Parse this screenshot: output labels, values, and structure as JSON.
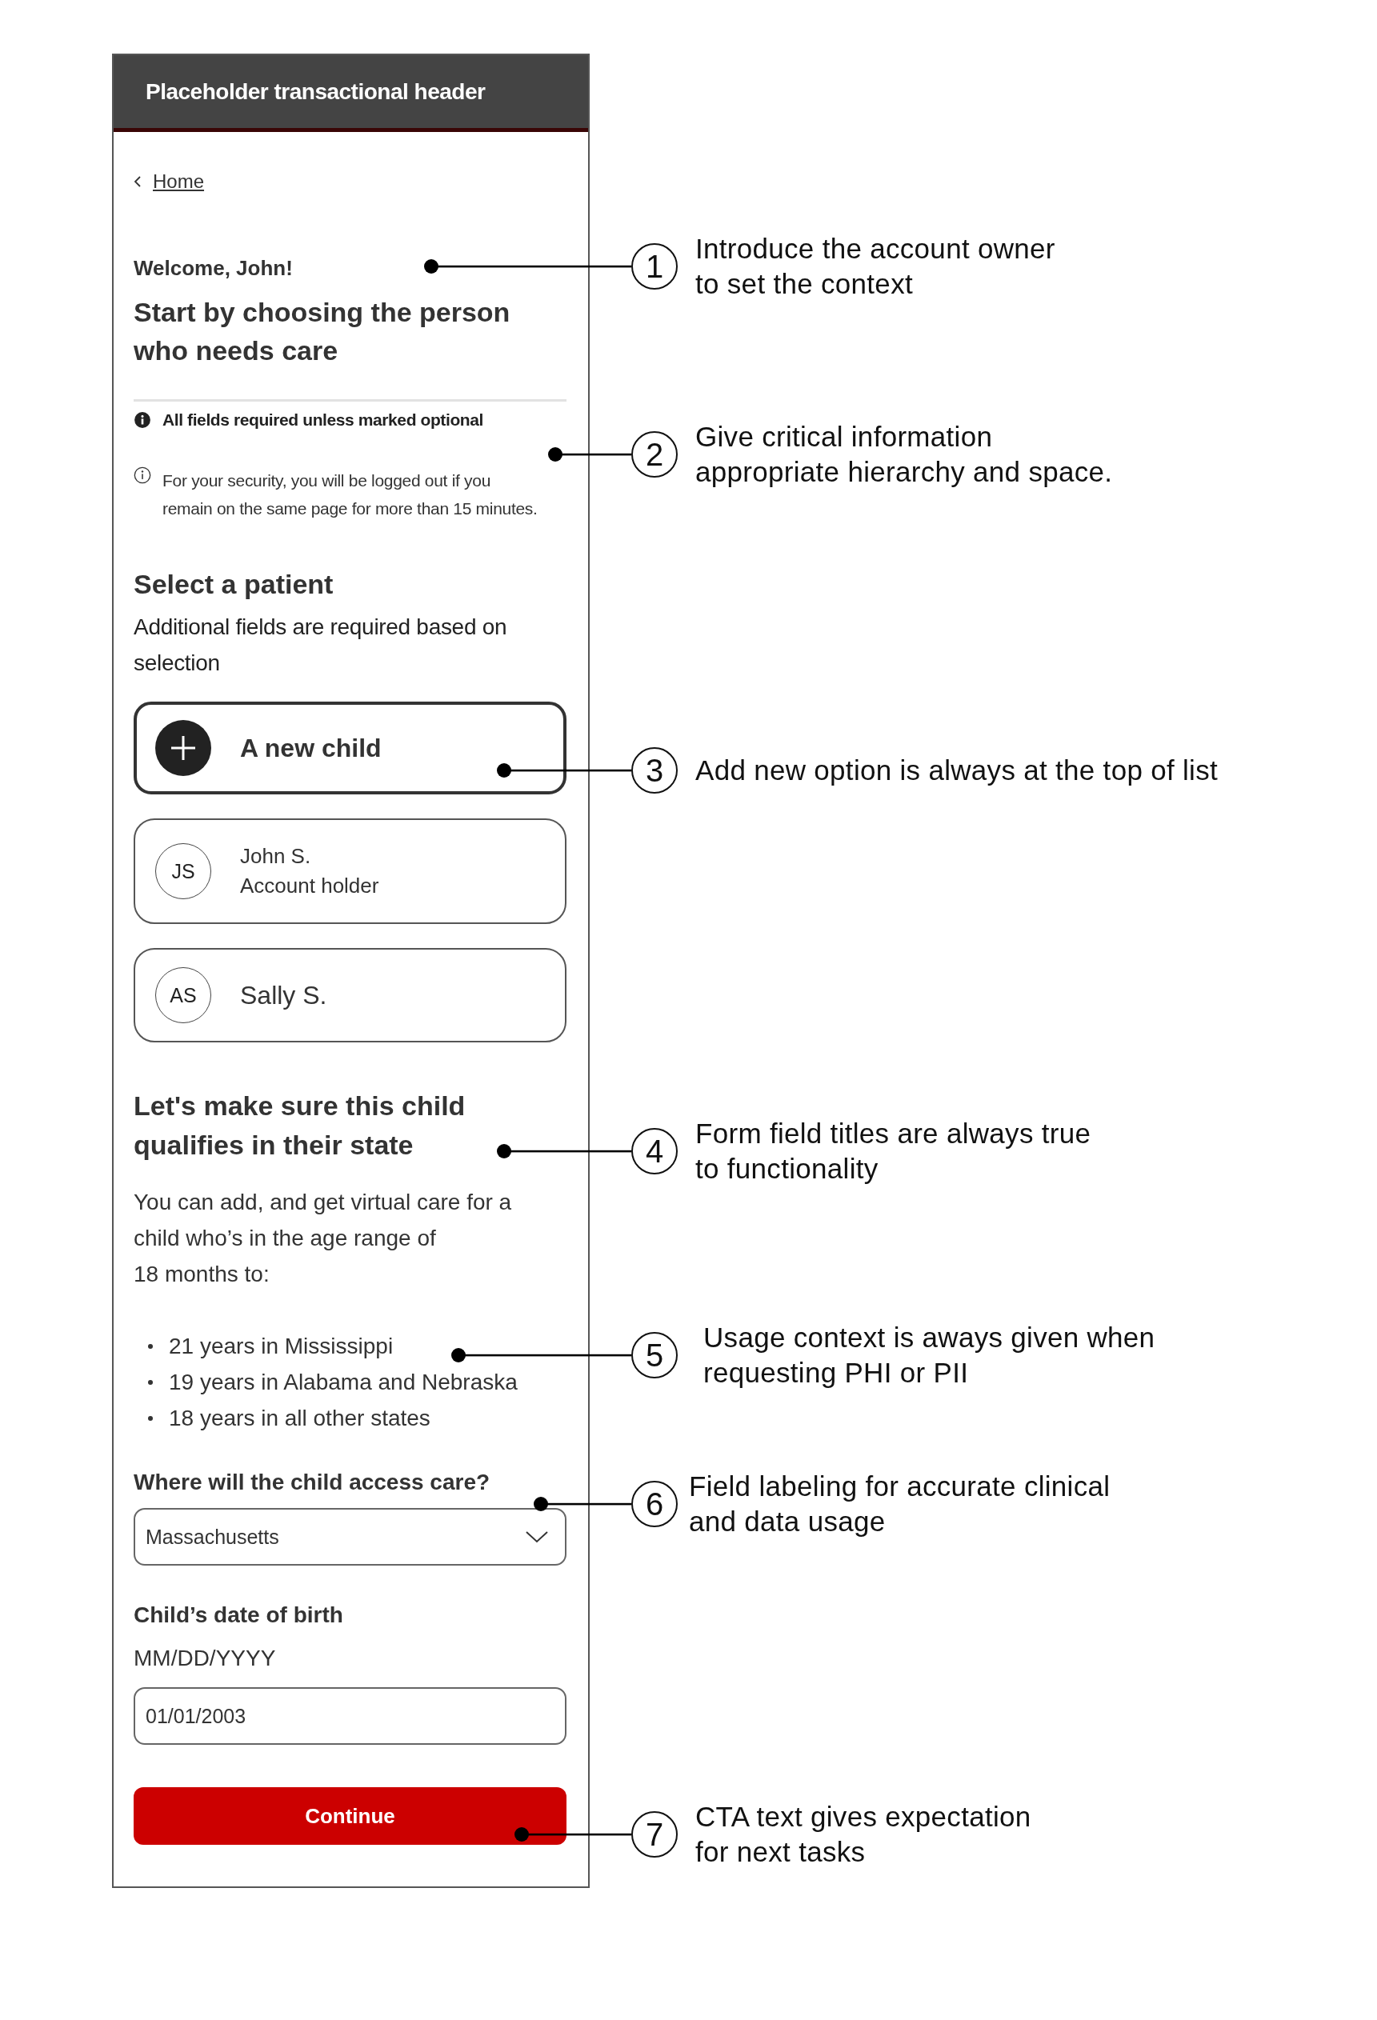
{
  "header": {
    "title": "Placeholder transactional header"
  },
  "back_link": {
    "label": "Home"
  },
  "greeting": "Welcome, John!",
  "heading": "Start by choosing the person who needs care",
  "required_note": "All fields required unless marked optional",
  "security_note": "For your security, you will be logged out if you remain on the same page for more than 15 minutes.",
  "patient_section": {
    "title": "Select a patient",
    "description": "Additional fields are required based on selection"
  },
  "patients": [
    {
      "kind": "add",
      "name": "A new child"
    },
    {
      "kind": "person",
      "initials": "JS",
      "name": "John S.",
      "role": "Account holder"
    },
    {
      "kind": "person",
      "initials": "AS",
      "name": "Sally S."
    }
  ],
  "qualify_section": {
    "title": "Let's make sure this child qualifies in their state",
    "description": "You can add, and get virtual care for a child who’s in the age range of\n18 months to:",
    "age_limits": [
      "21 years in Mississippi",
      "19 years in Alabama and Nebraska",
      "18 years in all other states"
    ]
  },
  "state_field": {
    "label": "Where will the child access care?",
    "value": "Massachusetts"
  },
  "dob_field": {
    "label": "Child’s date of birth",
    "hint": "MM/DD/YYYY",
    "value": "01/01/2003"
  },
  "continue_button": "Continue",
  "annotations": [
    {
      "number": "1",
      "text": "Introduce the account owner\nto set the context"
    },
    {
      "number": "2",
      "text": "Give critical information\nappropriate hierarchy and space."
    },
    {
      "number": "3",
      "text": "Add new option is always at the top of list"
    },
    {
      "number": "4",
      "text": "Form field titles are always true\nto functionality"
    },
    {
      "number": "5",
      "text": "Usage context is aways given when\nrequesting PHI or PII"
    },
    {
      "number": "6",
      "text": "Field labeling for accurate clinical\nand data usage"
    },
    {
      "number": "7",
      "text": "CTA text gives expectation\nfor next tasks"
    }
  ]
}
